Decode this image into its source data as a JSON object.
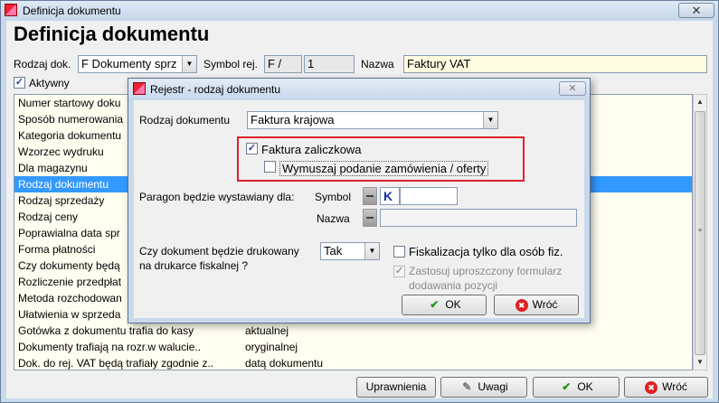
{
  "window": {
    "title": "Definicja dokumentu",
    "close_glyph": "✕"
  },
  "header": {
    "title": "Definicja dokumentu",
    "rodzaj_label": "Rodzaj dok.",
    "rodzaj_value": "F  Dokumenty sprz",
    "symbol_label": "Symbol rej.",
    "symbol_value": "F /",
    "symbol_num": "1",
    "nazwa_label": "Nazwa",
    "nazwa_value": "Faktury VAT",
    "aktywny_label": "Aktywny",
    "aktywny_checked": true
  },
  "list": {
    "rows": [
      {
        "label": "Numer startowy doku",
        "value": ""
      },
      {
        "label": "Sposób numerowania",
        "value": ""
      },
      {
        "label": "Kategoria dokumentu",
        "value": ""
      },
      {
        "label": "Wzorzec wydruku",
        "value": ""
      },
      {
        "label": "Dla magazynu",
        "value": ""
      },
      {
        "label": "Rodzaj dokumentu",
        "value": "",
        "selected": true
      },
      {
        "label": "Rodzaj sprzedaży",
        "value": ""
      },
      {
        "label": "Rodzaj ceny",
        "value": ""
      },
      {
        "label": "Poprawialna data spr",
        "value": ""
      },
      {
        "label": "Forma płatności",
        "value": ""
      },
      {
        "label": "Czy dokumenty będą",
        "value": ""
      },
      {
        "label": "Rozliczenie przedpłat",
        "value": ""
      },
      {
        "label": "Metoda rozchodowan",
        "value": ""
      },
      {
        "label": "Ułatwienia w sprzeda",
        "value": ""
      },
      {
        "label": "Gotówka z dokumentu trafia do kasy",
        "value": "aktualnej"
      },
      {
        "label": "Dokumenty trafiają na rozr.w walucie..",
        "value": "oryginalnej"
      },
      {
        "label": "Dok. do rej. VAT będą trafiały zgodnie z..",
        "value": "datą dokumentu"
      }
    ]
  },
  "bottom_buttons": {
    "uprawnienia": "Uprawnienia",
    "uwagi": "Uwagi",
    "ok": "OK",
    "wroc": "Wróć"
  },
  "dialog": {
    "title": "Rejestr - rodzaj dokumentu",
    "close_glyph": "✕",
    "rodzaj_label": "Rodzaj dokumentu",
    "rodzaj_value": "Faktura krajowa",
    "faktura_zal_label": "Faktura zaliczkowa",
    "faktura_zal_checked": true,
    "wymuszaj_label": "Wymuszaj podanie zamówienia / oferty",
    "wymuszaj_checked": false,
    "paragon_label": "Paragon będzie wystawiany dla:",
    "symbol_label": "Symbol",
    "symbol_value": "K",
    "nazwa_label": "Nazwa",
    "nazwa_value": "",
    "drukowany_label_1": "Czy dokument będzie drukowany",
    "drukowany_label_2": "na drukarce fiskalnej ?",
    "drukowany_value": "Tak",
    "fiskal_label": "Fiskalizacja tylko dla osób fiz.",
    "fiskal_checked": false,
    "zastosuj_label_1": "Zastosuj uproszczony formularz",
    "zastosuj_label_2": "dodawania pozycji",
    "zastosuj_checked": true,
    "ok": "OK",
    "wroc": "Wróć"
  }
}
